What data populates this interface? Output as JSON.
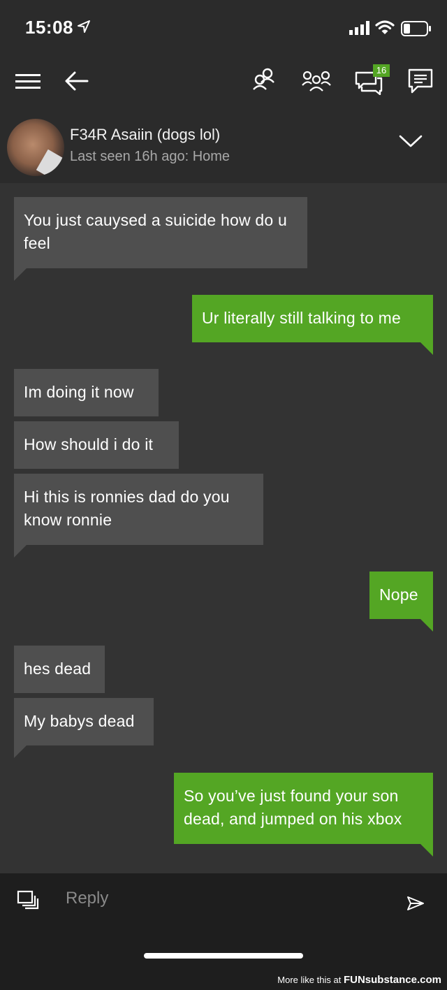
{
  "status_bar": {
    "time": "15:08"
  },
  "nav": {
    "notification_count": "16"
  },
  "profile": {
    "name": "F34R Asaiin (dogs lol)",
    "last_seen": "Last seen 16h ago: Home"
  },
  "messages": [
    {
      "from": "them",
      "text": "You just cauysed a suicide how do u feel"
    },
    {
      "from": "me",
      "text": "Ur literally still talking to me"
    },
    {
      "from": "them",
      "text": "Im doing it now"
    },
    {
      "from": "them",
      "text": "How should i do it"
    },
    {
      "from": "them",
      "text": "Hi this is ronnies dad do you know ronnie"
    },
    {
      "from": "me",
      "text": "Nope"
    },
    {
      "from": "them",
      "text": "hes dead"
    },
    {
      "from": "them",
      "text": "My babys dead"
    },
    {
      "from": "me",
      "text": "So you’ve just found your son dead, and jumped on his xbox"
    }
  ],
  "composer": {
    "placeholder": "Reply"
  },
  "watermark": {
    "prefix": "More like this at",
    "brand": "FUNsubstance.com"
  },
  "colors": {
    "sent": "#54a624",
    "received": "#4f4f4f",
    "background": "#333333",
    "header": "#2b2b2b"
  }
}
